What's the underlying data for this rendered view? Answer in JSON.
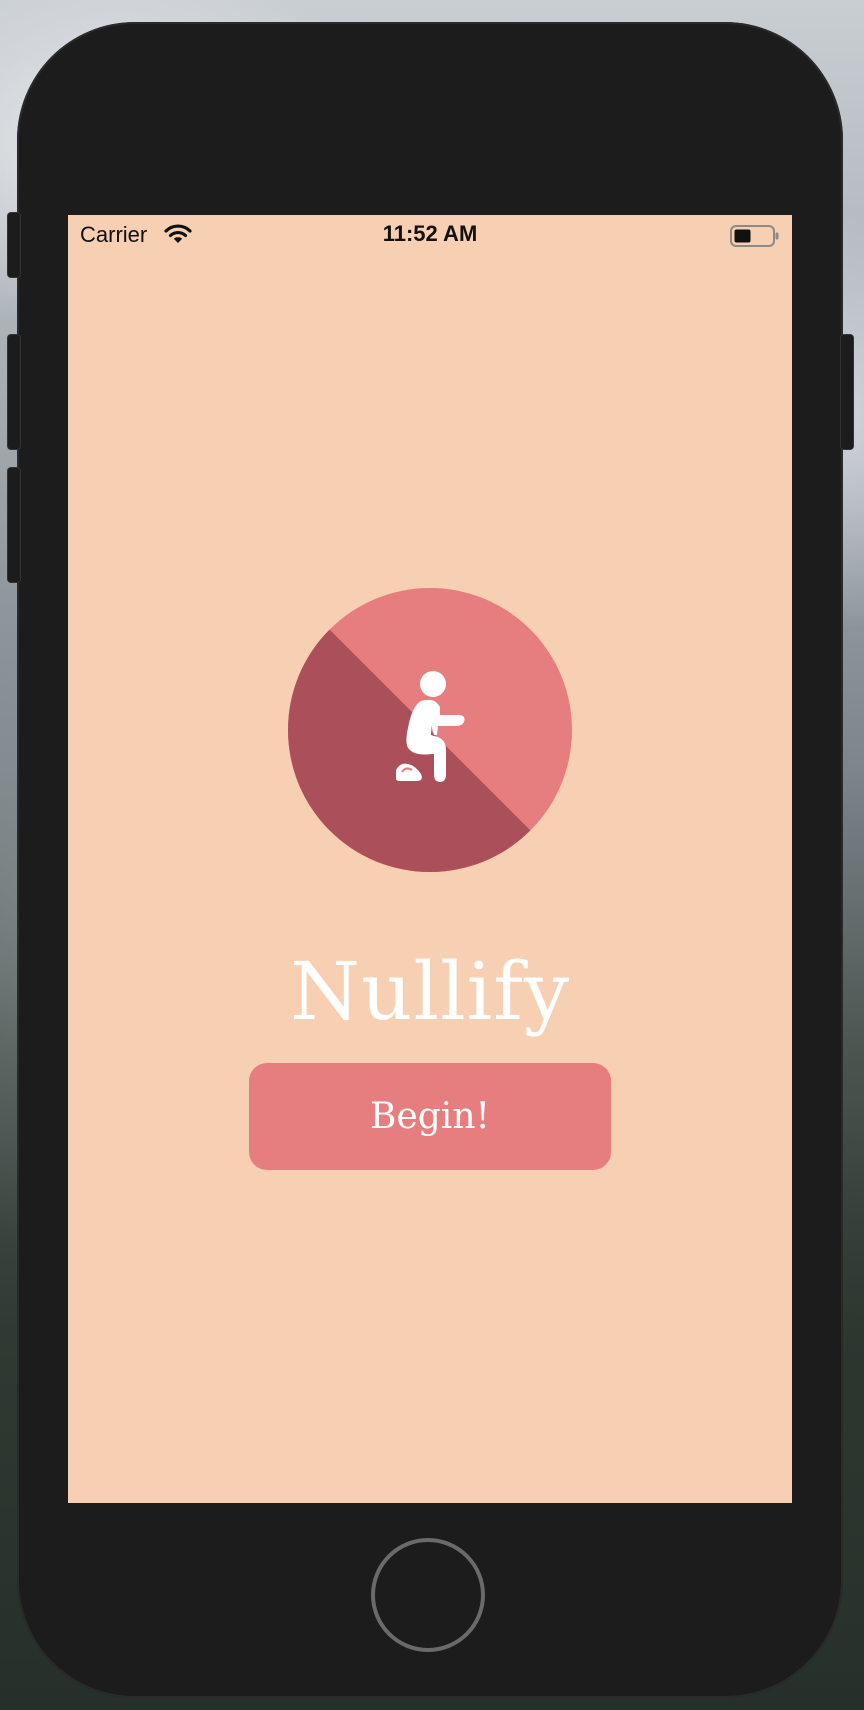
{
  "status_bar": {
    "carrier": "Carrier",
    "time": "11:52 AM",
    "wifi_icon": "wifi-icon",
    "battery_icon": "battery-icon"
  },
  "app": {
    "title": "Nullify",
    "logo_icon": "squatting-person-icon",
    "begin_label": "Begin!"
  },
  "colors": {
    "screen_background": "#f7cfb2",
    "accent": "#e67e80",
    "accent_dark": "#ab505a",
    "text_light": "#ffffff"
  }
}
